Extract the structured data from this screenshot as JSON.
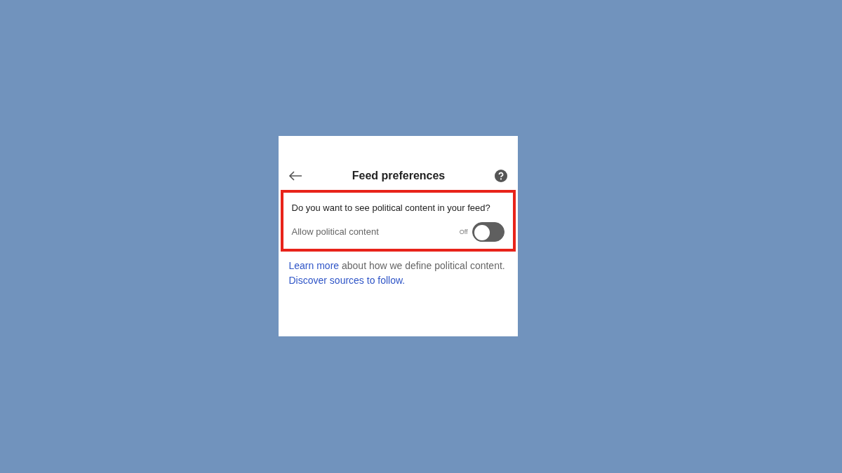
{
  "header": {
    "title": "Feed preferences"
  },
  "setting": {
    "highlighted": true,
    "question": "Do you want to see political content in your feed?",
    "label": "Allow political content",
    "state_label": "Off",
    "on": false
  },
  "footer": [
    {
      "kind": "link",
      "text": "Learn more"
    },
    {
      "kind": "text",
      "text": " about how we define political content. "
    },
    {
      "kind": "link",
      "text": "Discover sources to follow."
    }
  ]
}
